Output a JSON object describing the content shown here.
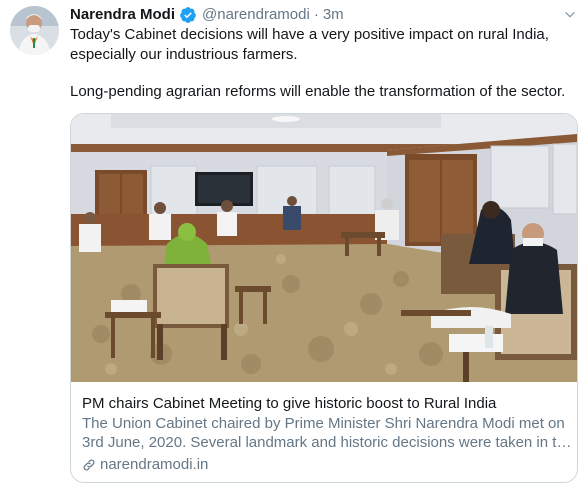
{
  "tweet": {
    "author_name": "Narendra Modi",
    "handle": "@narendramodi",
    "separator": "·",
    "time": "3m",
    "text_lines": [
      "Today's Cabinet decisions will have a very positive impact on rural India,",
      "especially our industrious farmers.",
      "Long-pending agrarian reforms will enable the transformation of the sector."
    ]
  },
  "card": {
    "title": "PM chairs Cabinet Meeting to give historic boost to Rural India",
    "description_lines": [
      "The Union Cabinet chaired by Prime Minister Shri Narendra Modi met on",
      "3rd June, 2020. Several landmark and historic decisions were taken in th..."
    ],
    "domain": "narendramodi.in"
  },
  "icons": {
    "verified": "verified-badge-icon",
    "caret": "chevron-down-icon",
    "link": "link-icon"
  },
  "colors": {
    "accent": "#1da1f2",
    "secondary_text": "#657786",
    "border": "#ccd6dd"
  }
}
